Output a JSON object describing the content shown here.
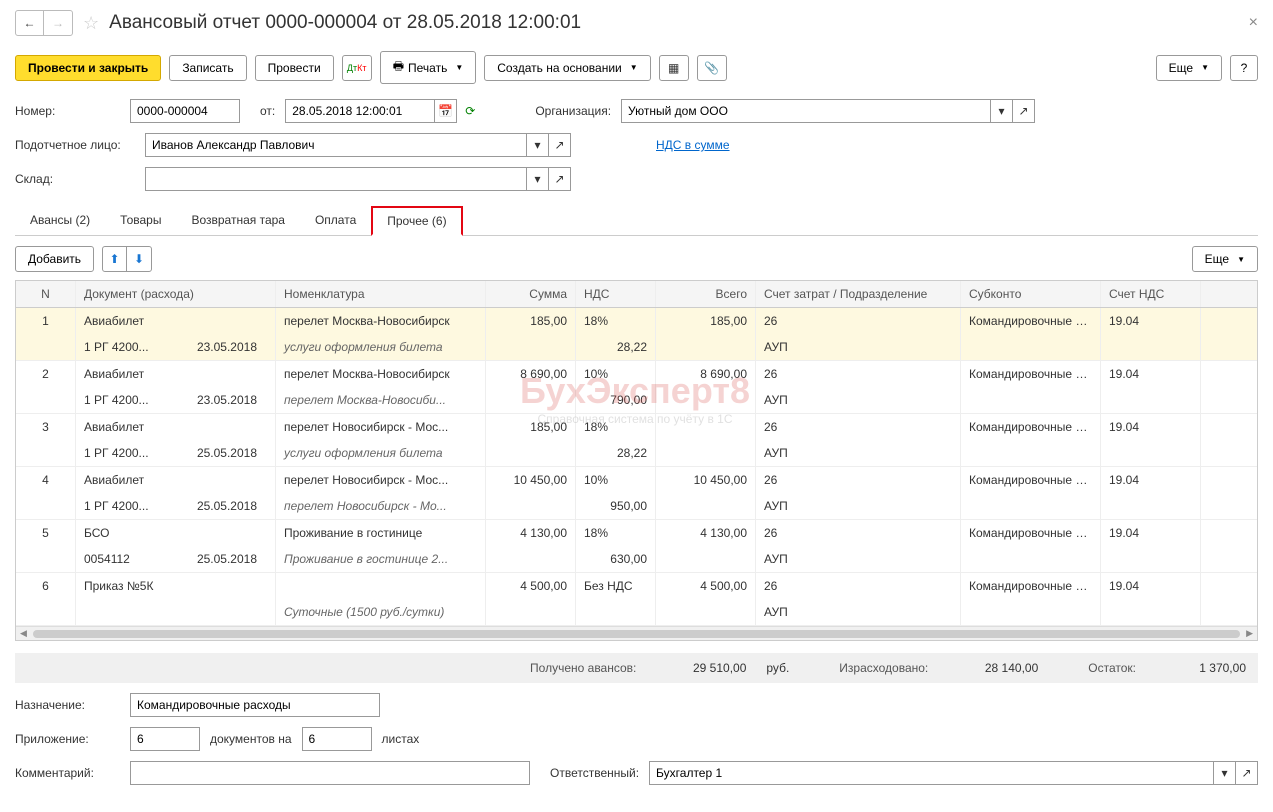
{
  "header": {
    "title": "Авансовый отчет 0000-000004 от 28.05.2018 12:00:01"
  },
  "toolbar": {
    "post_close": "Провести и закрыть",
    "save": "Записать",
    "post": "Провести",
    "print": "Печать",
    "create_based": "Создать на основании",
    "more": "Еще",
    "help": "?"
  },
  "form": {
    "number_label": "Номер:",
    "number": "0000-000004",
    "from_label": "от:",
    "date": "28.05.2018 12:00:01",
    "org_label": "Организация:",
    "org": "Уютный дом ООО",
    "person_label": "Подотчетное лицо:",
    "person": "Иванов Александр Павлович",
    "vat_link": "НДС в сумме",
    "warehouse_label": "Склад:",
    "warehouse": ""
  },
  "tabs": {
    "advances": "Авансы (2)",
    "goods": "Товары",
    "returnable": "Возвратная тара",
    "payment": "Оплата",
    "other": "Прочее (6)"
  },
  "tab_toolbar": {
    "add": "Добавить",
    "more": "Еще"
  },
  "grid": {
    "headers": {
      "n": "N",
      "doc": "Документ (расхода)",
      "nom": "Номенклатура",
      "sum": "Сумма",
      "nds": "НДС",
      "total": "Всего",
      "acc": "Счет затрат / Подразделение",
      "sub": "Субконто",
      "ndsacc": "Счет НДС"
    },
    "rows": [
      {
        "n": "1",
        "doc_a": "Авиабилет",
        "doc_b1": "1 РГ 4200...",
        "doc_b2": "23.05.2018",
        "nom_a": "перелет Москва-Новосибирск",
        "nom_b": "услуги оформления билета",
        "sum": "185,00",
        "nds_a": "18%",
        "nds_b": "28,22",
        "total": "185,00",
        "acc_a": "26",
        "acc_b": "АУП",
        "sub": "Командировочные расходы",
        "ndsacc": "19.04"
      },
      {
        "n": "2",
        "doc_a": "Авиабилет",
        "doc_b1": "1 РГ 4200...",
        "doc_b2": "23.05.2018",
        "nom_a": "перелет Москва-Новосибирск",
        "nom_b": "перелет Москва-Новосиби...",
        "sum": "8 690,00",
        "nds_a": "10%",
        "nds_b": "790,00",
        "total": "8 690,00",
        "acc_a": "26",
        "acc_b": "АУП",
        "sub": "Командировочные расходы",
        "ndsacc": "19.04"
      },
      {
        "n": "3",
        "doc_a": "Авиабилет",
        "doc_b1": "1 РГ 4200...",
        "doc_b2": "25.05.2018",
        "nom_a": "перелет Новосибирск - Мос...",
        "nom_b": "услуги оформления билета",
        "sum": "185,00",
        "nds_a": "18%",
        "nds_b": "28,22",
        "total": "",
        "acc_a": "26",
        "acc_b": "АУП",
        "sub": "Командировочные расходы",
        "ndsacc": "19.04"
      },
      {
        "n": "4",
        "doc_a": "Авиабилет",
        "doc_b1": "1 РГ 4200...",
        "doc_b2": "25.05.2018",
        "nom_a": "перелет Новосибирск - Мос...",
        "nom_b": "перелет Новосибирск - Мо...",
        "sum": "10 450,00",
        "nds_a": "10%",
        "nds_b": "950,00",
        "total": "10 450,00",
        "acc_a": "26",
        "acc_b": "АУП",
        "sub": "Командировочные расходы",
        "ndsacc": "19.04"
      },
      {
        "n": "5",
        "doc_a": "БСО",
        "doc_b1": "0054112",
        "doc_b2": "25.05.2018",
        "nom_a": "Проживание в гостинице",
        "nom_b": "Проживание в гостинице 2...",
        "sum": "4 130,00",
        "nds_a": "18%",
        "nds_b": "630,00",
        "total": "4 130,00",
        "acc_a": "26",
        "acc_b": "АУП",
        "sub": "Командировочные расходы",
        "ndsacc": "19.04"
      },
      {
        "n": "6",
        "doc_a": "Приказ №5К",
        "doc_b1": "",
        "doc_b2": "",
        "nom_a": "",
        "nom_b": "Суточные (1500 руб./сутки)",
        "sum": "4 500,00",
        "nds_a": "Без НДС",
        "nds_b": "",
        "total": "4 500,00",
        "acc_a": "26",
        "acc_b": "АУП",
        "sub": "Командировочные расходы",
        "ndsacc": "19.04"
      }
    ]
  },
  "totals": {
    "received_label": "Получено авансов:",
    "received": "29 510,00",
    "currency": "руб.",
    "spent_label": "Израсходовано:",
    "spent": "28 140,00",
    "remainder_label": "Остаток:",
    "remainder": "1 370,00"
  },
  "bottom": {
    "purpose_label": "Назначение:",
    "purpose": "Командировочные расходы",
    "attach_label": "Приложение:",
    "attach_docs": "6",
    "attach_mid": "документов на",
    "attach_sheets": "6",
    "attach_end": "листах",
    "comment_label": "Комментарий:",
    "comment": "",
    "resp_label": "Ответственный:",
    "resp": "Бухгалтер 1"
  },
  "watermark": {
    "title": "БухЭксперт8",
    "sub": "Справочная система по учёту в 1С"
  }
}
